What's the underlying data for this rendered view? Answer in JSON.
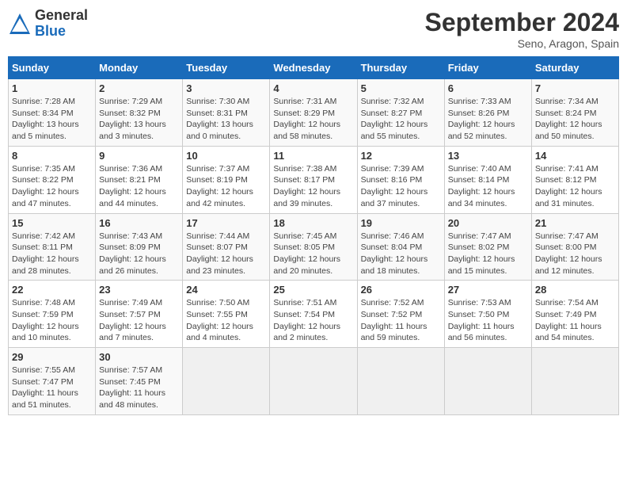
{
  "header": {
    "logo": {
      "general": "General",
      "blue": "Blue"
    },
    "title": "September 2024",
    "subtitle": "Seno, Aragon, Spain"
  },
  "weekdays": [
    "Sunday",
    "Monday",
    "Tuesday",
    "Wednesday",
    "Thursday",
    "Friday",
    "Saturday"
  ],
  "days": [
    {
      "date": "1",
      "sunrise": "Sunrise: 7:28 AM",
      "sunset": "Sunset: 8:34 PM",
      "daylight": "Daylight: 13 hours and 5 minutes."
    },
    {
      "date": "2",
      "sunrise": "Sunrise: 7:29 AM",
      "sunset": "Sunset: 8:32 PM",
      "daylight": "Daylight: 13 hours and 3 minutes."
    },
    {
      "date": "3",
      "sunrise": "Sunrise: 7:30 AM",
      "sunset": "Sunset: 8:31 PM",
      "daylight": "Daylight: 13 hours and 0 minutes."
    },
    {
      "date": "4",
      "sunrise": "Sunrise: 7:31 AM",
      "sunset": "Sunset: 8:29 PM",
      "daylight": "Daylight: 12 hours and 58 minutes."
    },
    {
      "date": "5",
      "sunrise": "Sunrise: 7:32 AM",
      "sunset": "Sunset: 8:27 PM",
      "daylight": "Daylight: 12 hours and 55 minutes."
    },
    {
      "date": "6",
      "sunrise": "Sunrise: 7:33 AM",
      "sunset": "Sunset: 8:26 PM",
      "daylight": "Daylight: 12 hours and 52 minutes."
    },
    {
      "date": "7",
      "sunrise": "Sunrise: 7:34 AM",
      "sunset": "Sunset: 8:24 PM",
      "daylight": "Daylight: 12 hours and 50 minutes."
    },
    {
      "date": "8",
      "sunrise": "Sunrise: 7:35 AM",
      "sunset": "Sunset: 8:22 PM",
      "daylight": "Daylight: 12 hours and 47 minutes."
    },
    {
      "date": "9",
      "sunrise": "Sunrise: 7:36 AM",
      "sunset": "Sunset: 8:21 PM",
      "daylight": "Daylight: 12 hours and 44 minutes."
    },
    {
      "date": "10",
      "sunrise": "Sunrise: 7:37 AM",
      "sunset": "Sunset: 8:19 PM",
      "daylight": "Daylight: 12 hours and 42 minutes."
    },
    {
      "date": "11",
      "sunrise": "Sunrise: 7:38 AM",
      "sunset": "Sunset: 8:17 PM",
      "daylight": "Daylight: 12 hours and 39 minutes."
    },
    {
      "date": "12",
      "sunrise": "Sunrise: 7:39 AM",
      "sunset": "Sunset: 8:16 PM",
      "daylight": "Daylight: 12 hours and 37 minutes."
    },
    {
      "date": "13",
      "sunrise": "Sunrise: 7:40 AM",
      "sunset": "Sunset: 8:14 PM",
      "daylight": "Daylight: 12 hours and 34 minutes."
    },
    {
      "date": "14",
      "sunrise": "Sunrise: 7:41 AM",
      "sunset": "Sunset: 8:12 PM",
      "daylight": "Daylight: 12 hours and 31 minutes."
    },
    {
      "date": "15",
      "sunrise": "Sunrise: 7:42 AM",
      "sunset": "Sunset: 8:11 PM",
      "daylight": "Daylight: 12 hours and 28 minutes."
    },
    {
      "date": "16",
      "sunrise": "Sunrise: 7:43 AM",
      "sunset": "Sunset: 8:09 PM",
      "daylight": "Daylight: 12 hours and 26 minutes."
    },
    {
      "date": "17",
      "sunrise": "Sunrise: 7:44 AM",
      "sunset": "Sunset: 8:07 PM",
      "daylight": "Daylight: 12 hours and 23 minutes."
    },
    {
      "date": "18",
      "sunrise": "Sunrise: 7:45 AM",
      "sunset": "Sunset: 8:05 PM",
      "daylight": "Daylight: 12 hours and 20 minutes."
    },
    {
      "date": "19",
      "sunrise": "Sunrise: 7:46 AM",
      "sunset": "Sunset: 8:04 PM",
      "daylight": "Daylight: 12 hours and 18 minutes."
    },
    {
      "date": "20",
      "sunrise": "Sunrise: 7:47 AM",
      "sunset": "Sunset: 8:02 PM",
      "daylight": "Daylight: 12 hours and 15 minutes."
    },
    {
      "date": "21",
      "sunrise": "Sunrise: 7:47 AM",
      "sunset": "Sunset: 8:00 PM",
      "daylight": "Daylight: 12 hours and 12 minutes."
    },
    {
      "date": "22",
      "sunrise": "Sunrise: 7:48 AM",
      "sunset": "Sunset: 7:59 PM",
      "daylight": "Daylight: 12 hours and 10 minutes."
    },
    {
      "date": "23",
      "sunrise": "Sunrise: 7:49 AM",
      "sunset": "Sunset: 7:57 PM",
      "daylight": "Daylight: 12 hours and 7 minutes."
    },
    {
      "date": "24",
      "sunrise": "Sunrise: 7:50 AM",
      "sunset": "Sunset: 7:55 PM",
      "daylight": "Daylight: 12 hours and 4 minutes."
    },
    {
      "date": "25",
      "sunrise": "Sunrise: 7:51 AM",
      "sunset": "Sunset: 7:54 PM",
      "daylight": "Daylight: 12 hours and 2 minutes."
    },
    {
      "date": "26",
      "sunrise": "Sunrise: 7:52 AM",
      "sunset": "Sunset: 7:52 PM",
      "daylight": "Daylight: 11 hours and 59 minutes."
    },
    {
      "date": "27",
      "sunrise": "Sunrise: 7:53 AM",
      "sunset": "Sunset: 7:50 PM",
      "daylight": "Daylight: 11 hours and 56 minutes."
    },
    {
      "date": "28",
      "sunrise": "Sunrise: 7:54 AM",
      "sunset": "Sunset: 7:49 PM",
      "daylight": "Daylight: 11 hours and 54 minutes."
    },
    {
      "date": "29",
      "sunrise": "Sunrise: 7:55 AM",
      "sunset": "Sunset: 7:47 PM",
      "daylight": "Daylight: 11 hours and 51 minutes."
    },
    {
      "date": "30",
      "sunrise": "Sunrise: 7:57 AM",
      "sunset": "Sunset: 7:45 PM",
      "daylight": "Daylight: 11 hours and 48 minutes."
    }
  ]
}
